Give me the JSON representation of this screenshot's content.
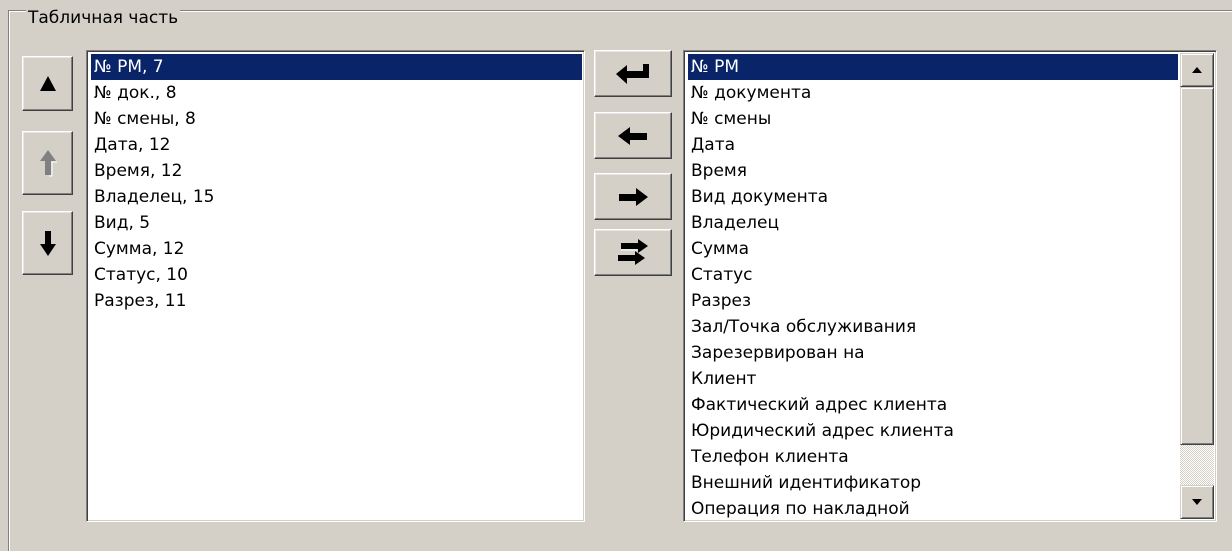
{
  "group": {
    "title": "Табличная часть"
  },
  "order_buttons": {
    "up": {
      "icon": "arrow-up-icon",
      "enabled": true
    },
    "up_disabled": {
      "icon": "arrow-up-icon",
      "enabled": false
    },
    "down": {
      "icon": "arrow-down-icon",
      "enabled": true
    }
  },
  "selected_columns": {
    "selected_index": 0,
    "items": [
      "№ РМ, 7",
      "№ док., 8",
      "№ смены, 8",
      "Дата, 12",
      "Время, 12",
      "Владелец, 15",
      "Вид, 5",
      "Сумма, 12",
      "Статус, 10",
      "Разрез, 11"
    ]
  },
  "transfer_buttons": {
    "enter": {
      "icon": "enter-arrow-icon"
    },
    "remove": {
      "icon": "arrow-left-icon"
    },
    "add": {
      "icon": "arrow-right-icon"
    },
    "swap": {
      "icon": "swap-arrows-icon"
    }
  },
  "available_columns": {
    "selected_index": 0,
    "items": [
      "№ РМ",
      "№ документа",
      "№ смены",
      "Дата",
      "Время",
      "Вид документа",
      "Владелец",
      "Сумма",
      "Статус",
      "Разрез",
      "Зал/Точка обслуживания",
      "Зарезервирован на",
      "Клиент",
      "Фактический адрес клиента",
      "Юридический адрес клиента",
      "Телефон клиента",
      "Внешний идентификатор",
      "Операция по накладной"
    ]
  },
  "scrollbar": {
    "up_icon": "scroll-up-arrow-icon",
    "down_icon": "scroll-down-arrow-icon"
  },
  "colors": {
    "face": "#d4d0c8",
    "selection": "#0a246a",
    "selection_text": "#ffffff"
  }
}
